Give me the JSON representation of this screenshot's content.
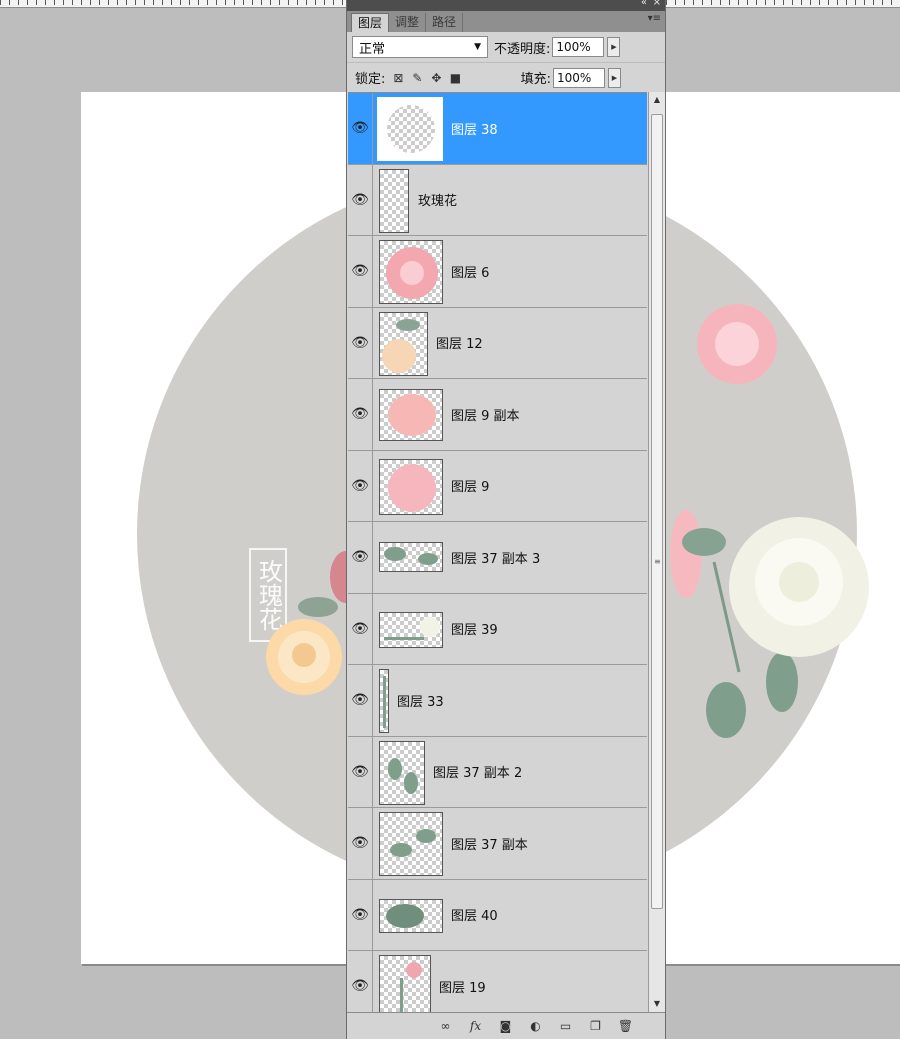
{
  "panel": {
    "tabs": [
      {
        "label": "图层"
      },
      {
        "label": "调整"
      },
      {
        "label": "路径"
      }
    ],
    "blend_mode": "正常",
    "opacity_label": "不透明度:",
    "opacity_value": "100%",
    "lock_label": "锁定:",
    "fill_label": "填充:",
    "fill_value": "100%"
  },
  "layers": [
    {
      "name": "图层 38",
      "selected": true,
      "visible": true
    },
    {
      "name": "玫瑰花",
      "selected": false,
      "visible": true
    },
    {
      "name": "图层 6",
      "selected": false,
      "visible": true
    },
    {
      "name": "图层 12",
      "selected": false,
      "visible": true
    },
    {
      "name": "图层 9 副本",
      "selected": false,
      "visible": true
    },
    {
      "name": "图层 9",
      "selected": false,
      "visible": true
    },
    {
      "name": "图层 37 副本 3",
      "selected": false,
      "visible": true
    },
    {
      "name": "图层 39",
      "selected": false,
      "visible": true
    },
    {
      "name": "图层 33",
      "selected": false,
      "visible": true
    },
    {
      "name": "图层 37 副本 2",
      "selected": false,
      "visible": true
    },
    {
      "name": "图层 37 副本",
      "selected": false,
      "visible": true
    },
    {
      "name": "图层 40",
      "selected": false,
      "visible": true
    },
    {
      "name": "图层 19",
      "selected": false,
      "visible": true
    }
  ],
  "canvas": {
    "title_text": "玫瑰花",
    "background_color": "#ffffff",
    "disc_color": "#d0ceca",
    "selection_color": "#3399ff"
  },
  "footer_icons": [
    "link-icon",
    "fx-icon",
    "mask-icon",
    "adjustment-icon",
    "folder-icon",
    "new-layer-icon",
    "trash-icon"
  ]
}
